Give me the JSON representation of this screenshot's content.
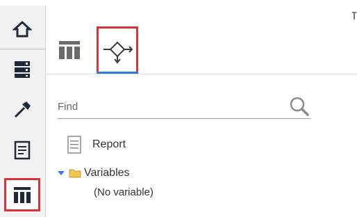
{
  "sidebar": {
    "items": [
      {
        "name": "home"
      },
      {
        "name": "data-server"
      },
      {
        "name": "build-hammer"
      },
      {
        "name": "report-page"
      },
      {
        "name": "table-columns",
        "selected": true
      }
    ]
  },
  "tabs": [
    {
      "name": "columns-tab",
      "icon": "columns-icon"
    },
    {
      "name": "variables-tab",
      "icon": "workflow-icon",
      "selected": true
    }
  ],
  "search": {
    "placeholder": "Find"
  },
  "tree": {
    "report_label": "Report",
    "variables_label": "Variables",
    "no_variable_label": "(No variable)"
  },
  "colors": {
    "accent_red": "#d8343b",
    "accent_blue": "#2f7ad6",
    "folder_yellow": "#e8b74a"
  }
}
